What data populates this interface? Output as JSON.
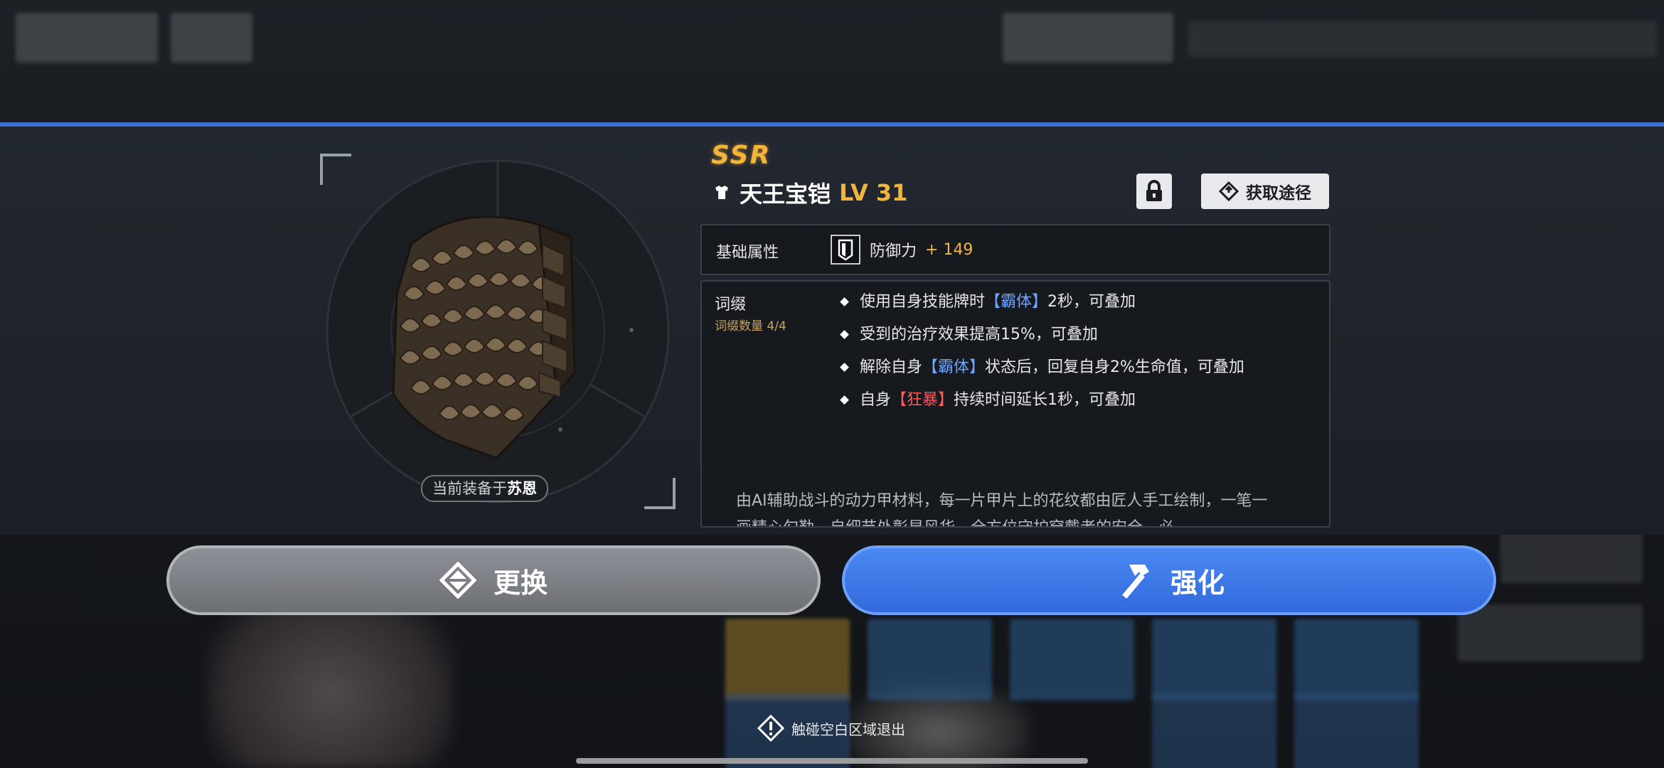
{
  "item": {
    "rarity": "SSR",
    "name": "天王宝铠",
    "level": "LV 31",
    "equipped_prefix": "当前装备于",
    "equipped_by": "苏恩"
  },
  "header_buttons": {
    "source_label": "获取途径"
  },
  "base_stats": {
    "label": "基础属性",
    "stat_name": "防御力",
    "stat_value": "+ 149"
  },
  "affixes": {
    "label": "词缀",
    "count_label": "词缀数量 4/4",
    "items": [
      {
        "pre": "使用自身技能牌时",
        "kw": "【霸体】",
        "post": "2秒，可叠加"
      },
      {
        "pre": "受到的治疗效果提高15%，可叠加",
        "kw": "",
        "post": ""
      },
      {
        "pre": "解除自身",
        "kw": "【霸体】",
        "post": "状态后，回复自身2%生命值，可叠加"
      },
      {
        "pre": "自身",
        "kw": "【狂暴】",
        "post": "持续时间延长1秒，可叠加"
      }
    ],
    "lore": "由AI辅助战斗的动力甲材料，每一片甲片上的花纹都由匠人手工绘制，一笔一画精心勾勒，自细节处彰显风华，全方位守护穿戴者的安全，必"
  },
  "actions": {
    "replace_label": "更换",
    "enhance_label": "强化"
  },
  "exit_hint": "触碰空白区域退出",
  "colors": {
    "accent_blue": "#3f6fd6",
    "rarity_gold": "#f3b43b",
    "keyword_blue": "#6fa6ff",
    "keyword_red": "#ff5a5a"
  }
}
